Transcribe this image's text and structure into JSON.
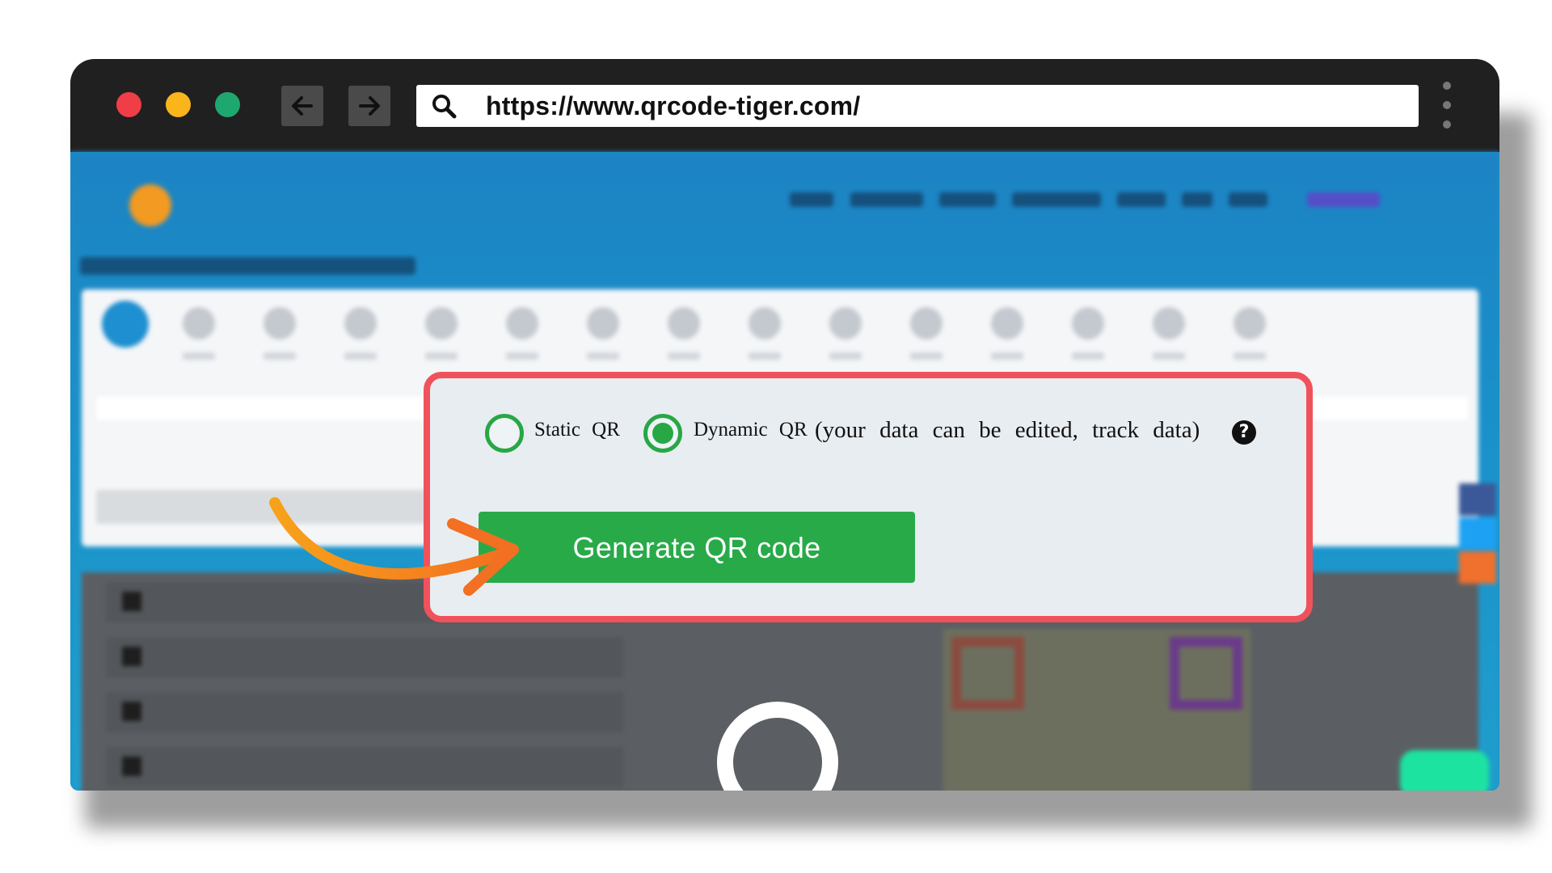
{
  "browser": {
    "url": "https://www.qrcode-tiger.com/",
    "back_icon": "arrow-left-icon",
    "forward_icon": "arrow-right-icon",
    "search_icon": "search-icon",
    "menu_icon": "kebab-menu-icon"
  },
  "popup": {
    "options": [
      {
        "label": "Static QR",
        "selected": false
      },
      {
        "label": "Dynamic QR",
        "selected": true
      }
    ],
    "dynamic_note": "(your data can be edited, track data)",
    "help_symbol": "?",
    "generate_label": "Generate QR code"
  },
  "colors": {
    "accent_green": "#29aa49",
    "highlight_border": "#f0525b",
    "arrow_orange": "#f5821f",
    "topbar": "#202020"
  }
}
